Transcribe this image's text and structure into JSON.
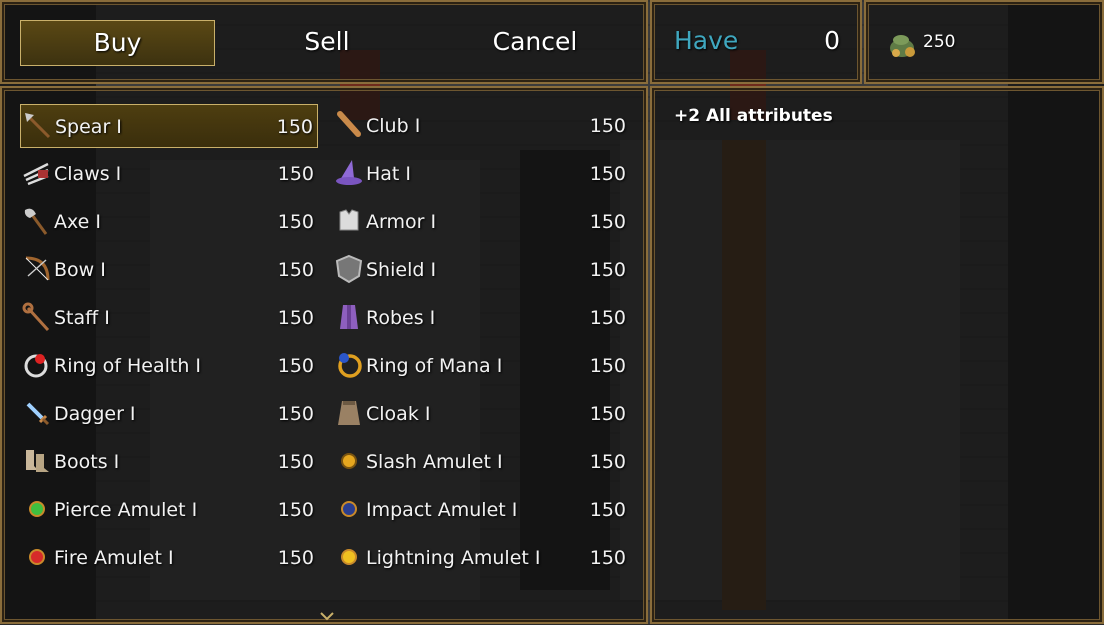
{
  "commands": {
    "buy": "Buy",
    "sell": "Sell",
    "cancel": "Cancel"
  },
  "have": {
    "label": "Have",
    "count": "0"
  },
  "gold": {
    "amount": "250",
    "icon": "gold-pouch-icon"
  },
  "description": "+2 All attributes",
  "items": [
    {
      "name": "Spear I",
      "price": "150",
      "icon": "spear-icon"
    },
    {
      "name": "Club I",
      "price": "150",
      "icon": "club-icon"
    },
    {
      "name": "Claws I",
      "price": "150",
      "icon": "claws-icon"
    },
    {
      "name": "Hat I",
      "price": "150",
      "icon": "hat-icon"
    },
    {
      "name": "Axe I",
      "price": "150",
      "icon": "axe-icon"
    },
    {
      "name": "Armor I",
      "price": "150",
      "icon": "armor-icon"
    },
    {
      "name": "Bow I",
      "price": "150",
      "icon": "bow-icon"
    },
    {
      "name": "Shield I",
      "price": "150",
      "icon": "shield-icon"
    },
    {
      "name": "Staff I",
      "price": "150",
      "icon": "staff-icon"
    },
    {
      "name": "Robes I",
      "price": "150",
      "icon": "robes-icon"
    },
    {
      "name": "Ring of Health I",
      "price": "150",
      "icon": "ring-of-health-icon"
    },
    {
      "name": "Ring of Mana I",
      "price": "150",
      "icon": "ring-of-mana-icon"
    },
    {
      "name": "Dagger I",
      "price": "150",
      "icon": "dagger-icon"
    },
    {
      "name": "Cloak I",
      "price": "150",
      "icon": "cloak-icon"
    },
    {
      "name": "Boots I",
      "price": "150",
      "icon": "boots-icon"
    },
    {
      "name": "Slash Amulet I",
      "price": "150",
      "icon": "slash-amulet-icon"
    },
    {
      "name": "Pierce Amulet I",
      "price": "150",
      "icon": "pierce-amulet-icon"
    },
    {
      "name": "Impact Amulet I",
      "price": "150",
      "icon": "impact-amulet-icon"
    },
    {
      "name": "Fire Amulet I",
      "price": "150",
      "icon": "fire-amulet-icon"
    },
    {
      "name": "Lightning Amulet I",
      "price": "150",
      "icon": "lightning-amulet-icon"
    }
  ],
  "colors": {
    "have_label": "#3fa7bf",
    "border": "#8a6d3b",
    "selection": "#c9b06a"
  }
}
